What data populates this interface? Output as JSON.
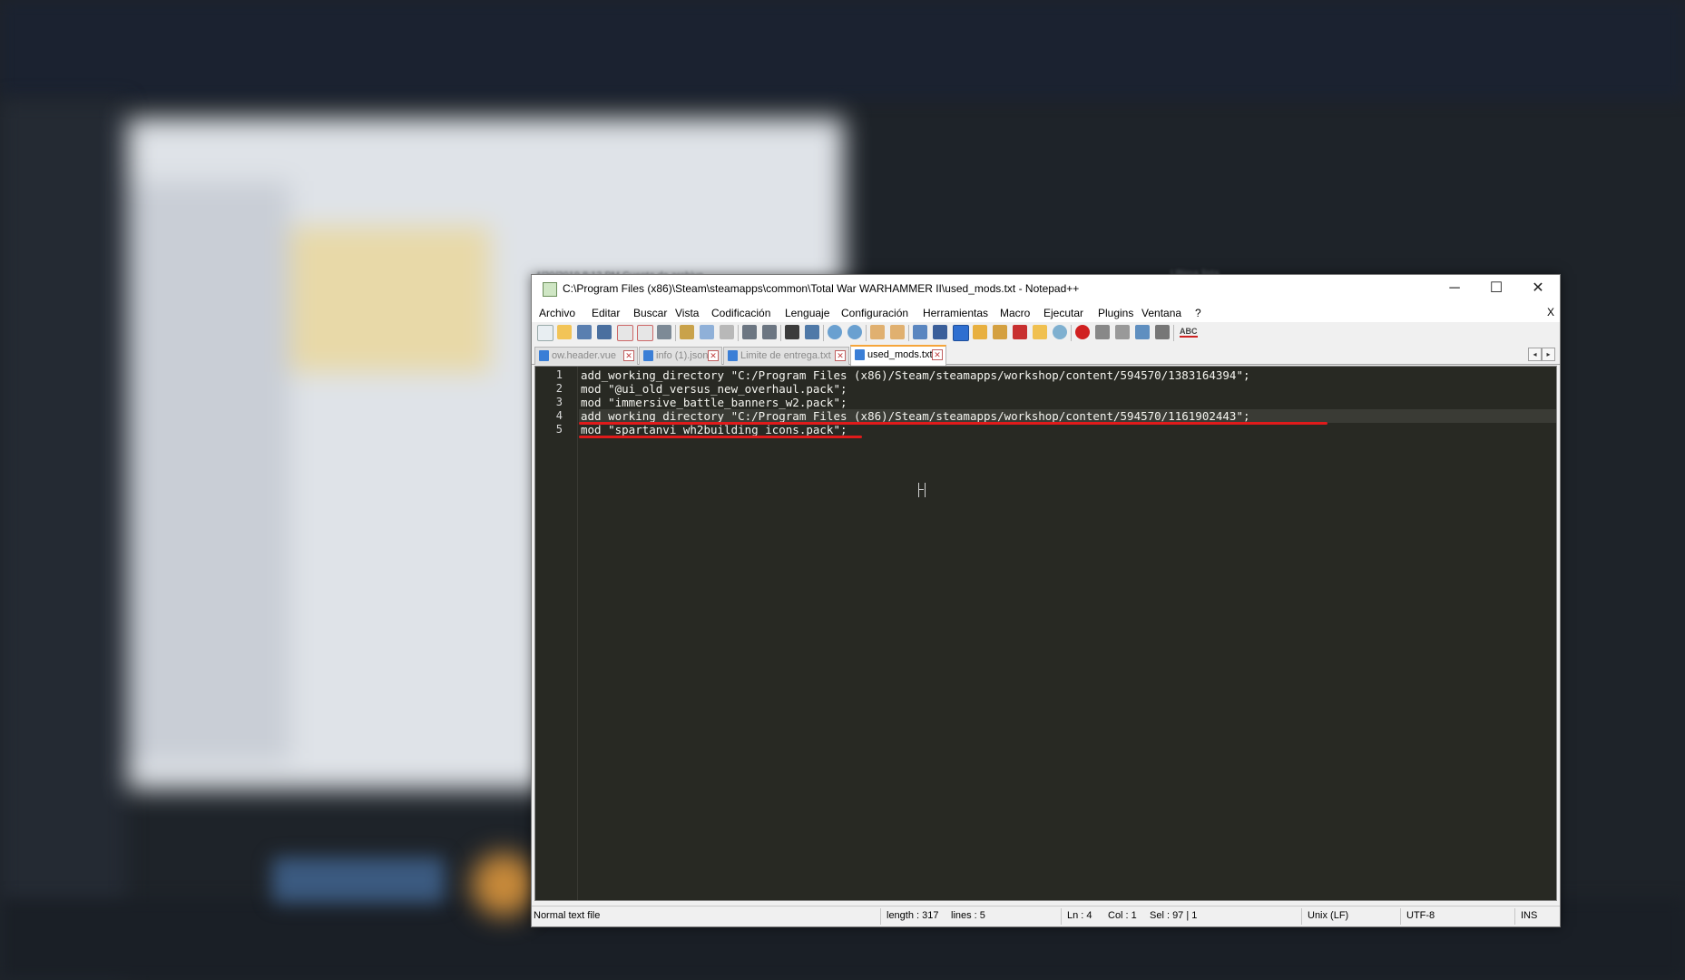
{
  "window": {
    "title": "C:\\Program Files (x86)\\Steam\\steamapps\\common\\Total War WARHAMMER II\\used_mods.txt - Notepad++",
    "controls": {
      "minimize": "─",
      "maximize": "☐",
      "close": "✕"
    }
  },
  "menubar": {
    "items": [
      "Archivo",
      "Editar",
      "Buscar",
      "Vista",
      "Codificación",
      "Lenguaje",
      "Configuración",
      "Herramientas",
      "Macro",
      "Ejecutar",
      "Plugins",
      "Ventana",
      "?"
    ],
    "close_doc": "X"
  },
  "toolbar": {
    "icons": [
      "new-file-icon",
      "open-file-icon",
      "save-icon",
      "save-all-icon",
      "close-icon",
      "close-all-icon",
      "print-icon",
      "cut-icon",
      "copy-icon",
      "paste-icon",
      "undo-icon",
      "redo-icon",
      "find-icon",
      "replace-icon",
      "zoom-in-icon",
      "zoom-out-icon",
      "sync-vertical-icon",
      "sync-horizontal-icon",
      "word-wrap-icon",
      "show-all-chars-icon",
      "indent-guide-icon",
      "doc-map-icon",
      "function-list-icon",
      "define-language-icon",
      "folder-workspace-icon",
      "monitoring-icon",
      "record-macro-icon",
      "stop-macro-icon",
      "play-macro-icon",
      "run-macro-multiple-icon",
      "save-macro-icon",
      "spell-check-icon"
    ],
    "spell_check_label": "ABC"
  },
  "tabs": [
    {
      "label": "ow.header.vue",
      "active": false
    },
    {
      "label": "info (1).json",
      "active": false
    },
    {
      "label": "Limite de entrega.txt",
      "active": false
    },
    {
      "label": "used_mods.txt",
      "active": true
    }
  ],
  "tab_nav": {
    "left": "◂",
    "right": "▸"
  },
  "editor": {
    "lines": [
      {
        "num": "1",
        "text": "add_working_directory \"C:/Program Files (x86)/Steam/steamapps/workshop/content/594570/1383164394\";"
      },
      {
        "num": "2",
        "text": "mod \"@ui_old_versus_new_overhaul.pack\";"
      },
      {
        "num": "3",
        "text": "mod \"immersive_battle_banners_w2.pack\";"
      },
      {
        "num": "4",
        "text": "add_working_directory \"C:/Program Files (x86)/Steam/steamapps/workshop/content/594570/1161902443\";"
      },
      {
        "num": "5",
        "text": "mod \"spartanvi_wh2building_icons.pack\";"
      }
    ],
    "current_line": 4,
    "colors": {
      "background": "#282923",
      "text": "#f5f5f0",
      "underline": "#e01b1b"
    }
  },
  "statusbar": {
    "file_type": "Normal text file",
    "length": "length : 317",
    "lines": "lines : 5",
    "ln": "Ln : 4",
    "col": "Col : 1",
    "sel": "Sel : 97 | 1",
    "eol": "Unix (LF)",
    "encoding": "UTF-8",
    "mode": "INS"
  },
  "background": {
    "blurred_text_left": "4/20/2019 8:12 PM     Cuenta de archivo",
    "blurred_text_right": "Ultima lista"
  }
}
